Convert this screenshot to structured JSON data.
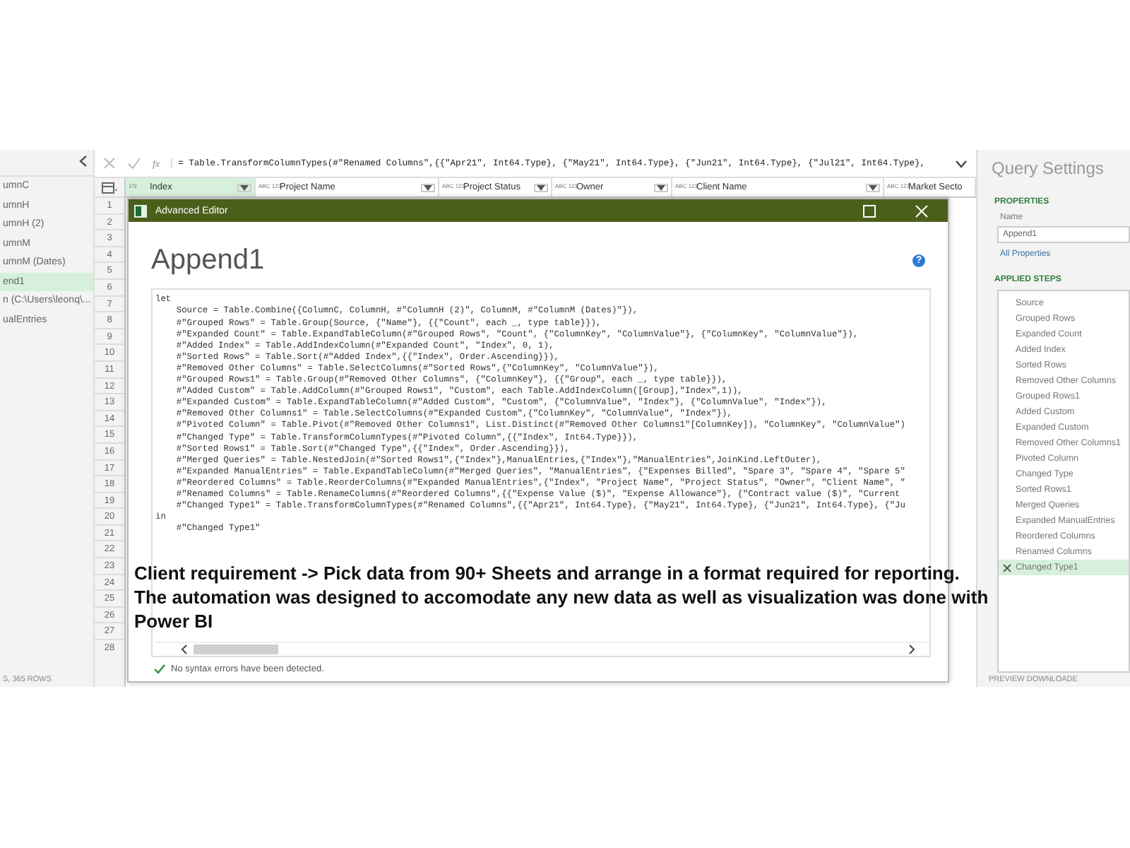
{
  "queries_panel": {
    "items": [
      {
        "label": "umnC",
        "selected": false
      },
      {
        "label": "umnH",
        "selected": false
      },
      {
        "label": "umnH (2)",
        "selected": false
      },
      {
        "label": "umnM",
        "selected": false
      },
      {
        "label": "umnM (Dates)",
        "selected": false
      },
      {
        "label": "end1",
        "selected": true
      },
      {
        "label": "n (C:\\Users\\leonq\\...",
        "selected": false
      },
      {
        "label": "ualEntries",
        "selected": false
      }
    ],
    "status": "S, 365 ROWS"
  },
  "formula_bar": {
    "fx": "fx",
    "formula": "= Table.TransformColumnTypes(#\"Renamed Columns\",{{\"Apr21\", Int64.Type}, {\"May21\", Int64.Type}, {\"Jun21\", Int64.Type}, {\"Jul21\", Int64.Type},"
  },
  "table": {
    "columns": [
      {
        "label": "Index",
        "type_icon": "1²3",
        "selected": true
      },
      {
        "label": "Project Name",
        "type_icon": "ABC 123",
        "selected": false
      },
      {
        "label": "Project Status",
        "type_icon": "ABC 123",
        "selected": false
      },
      {
        "label": "Owner",
        "type_icon": "ABC 123",
        "selected": false
      },
      {
        "label": "Client Name",
        "type_icon": "ABC 123",
        "selected": false
      },
      {
        "label": "Market Secto",
        "type_icon": "ABC 123",
        "selected": false
      }
    ],
    "row_numbers": [
      "1",
      "2",
      "3",
      "4",
      "5",
      "6",
      "7",
      "8",
      "9",
      "10",
      "11",
      "12",
      "13",
      "14",
      "15",
      "16",
      "17",
      "18",
      "19",
      "20",
      "21",
      "22",
      "23",
      "24",
      "25",
      "26",
      "27",
      "28"
    ]
  },
  "advanced_editor": {
    "title": "Advanced Editor",
    "heading": "Append1",
    "help": "?",
    "code_lines": [
      "let",
      "    Source = Table.Combine({ColumnC, ColumnH, #\"ColumnH (2)\", ColumnM, #\"ColumnM (Dates)\"}),",
      "    #\"Grouped Rows\" = Table.Group(Source, {\"Name\"}, {{\"Count\", each _, type table}}),",
      "    #\"Expanded Count\" = Table.ExpandTableColumn(#\"Grouped Rows\", \"Count\", {\"ColumnKey\", \"ColumnValue\"}, {\"ColumnKey\", \"ColumnValue\"}),",
      "    #\"Added Index\" = Table.AddIndexColumn(#\"Expanded Count\", \"Index\", 0, 1),",
      "    #\"Sorted Rows\" = Table.Sort(#\"Added Index\",{{\"Index\", Order.Ascending}}),",
      "    #\"Removed Other Columns\" = Table.SelectColumns(#\"Sorted Rows\",{\"ColumnKey\", \"ColumnValue\"}),",
      "    #\"Grouped Rows1\" = Table.Group(#\"Removed Other Columns\", {\"ColumnKey\"}, {{\"Group\", each _, type table}}),",
      "    #\"Added Custom\" = Table.AddColumn(#\"Grouped Rows1\", \"Custom\", each Table.AddIndexColumn([Group],\"Index\",1)),",
      "    #\"Expanded Custom\" = Table.ExpandTableColumn(#\"Added Custom\", \"Custom\", {\"ColumnValue\", \"Index\"}, {\"ColumnValue\", \"Index\"}),",
      "    #\"Removed Other Columns1\" = Table.SelectColumns(#\"Expanded Custom\",{\"ColumnKey\", \"ColumnValue\", \"Index\"}),",
      "    #\"Pivoted Column\" = Table.Pivot(#\"Removed Other Columns1\", List.Distinct(#\"Removed Other Columns1\"[ColumnKey]), \"ColumnKey\", \"ColumnValue\")",
      "    #\"Changed Type\" = Table.TransformColumnTypes(#\"Pivoted Column\",{{\"Index\", Int64.Type}}),",
      "    #\"Sorted Rows1\" = Table.Sort(#\"Changed Type\",{{\"Index\", Order.Ascending}}),",
      "    #\"Merged Queries\" = Table.NestedJoin(#\"Sorted Rows1\",{\"Index\"},ManualEntries,{\"Index\"},\"ManualEntries\",JoinKind.LeftOuter),",
      "    #\"Expanded ManualEntries\" = Table.ExpandTableColumn(#\"Merged Queries\", \"ManualEntries\", {\"Expenses Billed\", \"Spare 3\", \"Spare 4\", \"Spare 5\"",
      "    #\"Reordered Columns\" = Table.ReorderColumns(#\"Expanded ManualEntries\",{\"Index\", \"Project Name\", \"Project Status\", \"Owner\", \"Client Name\", \"",
      "    #\"Renamed Columns\" = Table.RenameColumns(#\"Reordered Columns\",{{\"Expense Value ($)\", \"Expense Allowance\"}, {\"Contract value ($)\", \"Current",
      "    #\"Changed Type1\" = Table.TransformColumnTypes(#\"Renamed Columns\",{{\"Apr21\", Int64.Type}, {\"May21\", Int64.Type}, {\"Jun21\", Int64.Type}, {\"Ju",
      "in",
      "    #\"Changed Type1\""
    ],
    "status": "No syntax errors have been detected."
  },
  "caption_lines": [
    "Client requirement -> Pick data from 90+ Sheets and arrange in a format required for reporting.",
    "The automation was designed to accomodate any new data as well as visualization was done with",
    "Power BI"
  ],
  "query_settings": {
    "title": "Query Settings",
    "properties_heading": "PROPERTIES",
    "name_label": "Name",
    "name_value": "Append1",
    "all_properties": "All Properties",
    "steps_heading": "APPLIED STEPS",
    "steps": [
      {
        "label": "Source",
        "selected": false
      },
      {
        "label": "Grouped Rows",
        "selected": false
      },
      {
        "label": "Expanded Count",
        "selected": false
      },
      {
        "label": "Added Index",
        "selected": false
      },
      {
        "label": "Sorted Rows",
        "selected": false
      },
      {
        "label": "Removed Other Columns",
        "selected": false
      },
      {
        "label": "Grouped Rows1",
        "selected": false
      },
      {
        "label": "Added Custom",
        "selected": false
      },
      {
        "label": "Expanded Custom",
        "selected": false
      },
      {
        "label": "Removed Other Columns1",
        "selected": false
      },
      {
        "label": "Pivoted Column",
        "selected": false
      },
      {
        "label": "Changed Type",
        "selected": false
      },
      {
        "label": "Sorted Rows1",
        "selected": false
      },
      {
        "label": "Merged Queries",
        "selected": false
      },
      {
        "label": "Expanded ManualEntries",
        "selected": false
      },
      {
        "label": "Reordered Columns",
        "selected": false
      },
      {
        "label": "Renamed Columns",
        "selected": false
      },
      {
        "label": "Changed Type1",
        "selected": true
      }
    ],
    "status": "PREVIEW DOWNLOADE"
  }
}
